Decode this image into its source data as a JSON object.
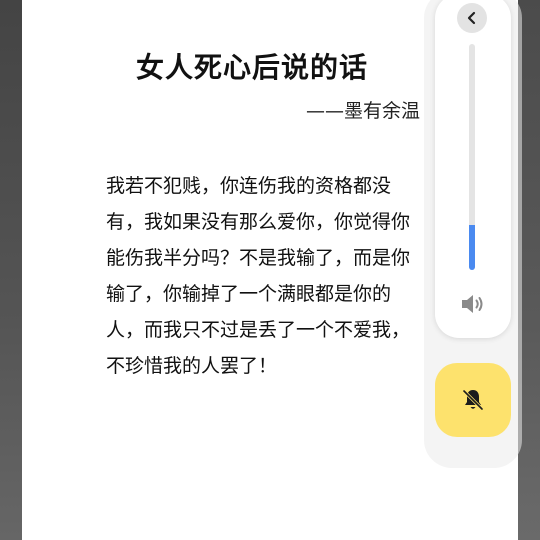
{
  "article": {
    "title": "女人死心后说的话",
    "author": "——墨有余温",
    "lines": [
      "我若不犯贱，你连伤我的资格都没",
      "有，我如果没有那么爱你，你觉得你",
      "能伤我半分吗？不是我输了，而是你",
      "输了，你输掉了一个满眼都是你的",
      "人，而我只不过是丢了一个不爱我，",
      "不珍惜我的人罢了！"
    ]
  },
  "volume_panel": {
    "level_fraction": 0.2,
    "accent_color": "#4a8af0",
    "mute_button_color": "#fde26d",
    "icons": [
      "chevron-left-icon",
      "speaker-icon",
      "bell-off-icon"
    ]
  }
}
